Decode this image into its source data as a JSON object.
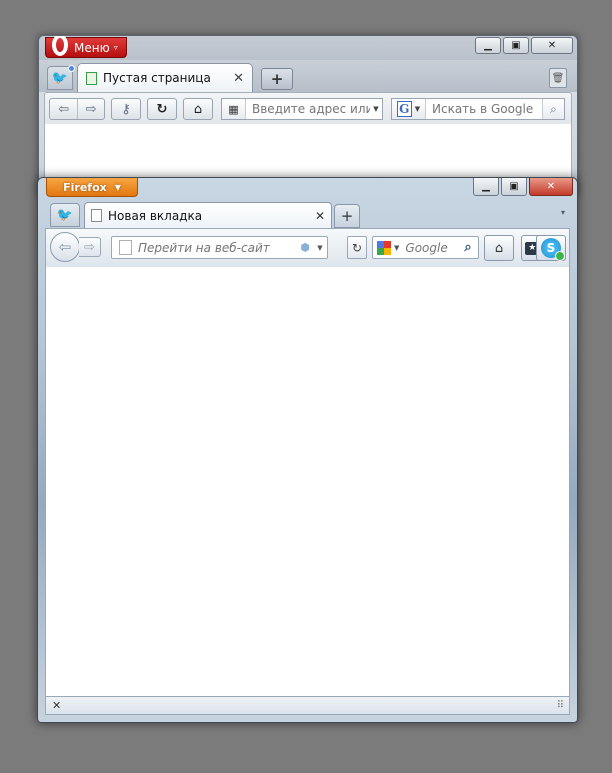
{
  "opera": {
    "menu_label": "Меню",
    "menu_chevron": "▿",
    "logo_icon": "opera-logo-icon",
    "window_buttons": {
      "minimize": "▁",
      "maximize": "▣",
      "close": "✕"
    },
    "tabs": [
      {
        "title": "Пустая страница",
        "close": "✕"
      }
    ],
    "newtab_label": "+",
    "address_placeholder": "Введите адрес или за",
    "search_placeholder": "Искать в Google",
    "search_engine_letter": "G",
    "colors": {
      "menu_red": "#c11a1a"
    }
  },
  "firefox": {
    "app_button_label": "Firefox",
    "app_button_chevron": "▼",
    "window_buttons": {
      "minimize": "▁",
      "maximize": "▣",
      "close": "✕"
    },
    "tabs": [
      {
        "title": "Новая вкладка",
        "close": "✕"
      }
    ],
    "newtab_label": "+",
    "tablist_chevron": "▾",
    "url_placeholder": "Перейти на веб-сайт",
    "search_placeholder": "Google",
    "status_close": "✕",
    "colors": {
      "app_button_orange": "#e87e14"
    }
  }
}
